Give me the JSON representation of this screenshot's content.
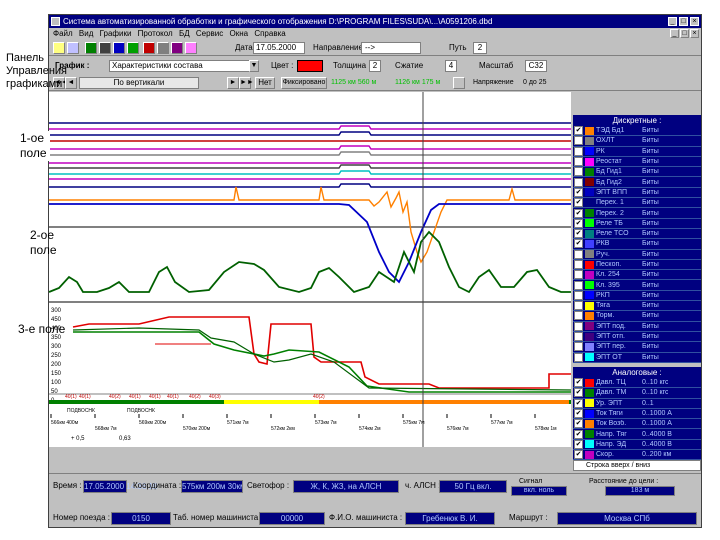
{
  "window": {
    "title": "Система автоматизированной обработки и графического отображения  D:\\PROGRAM FILES\\SUDA\\...\\A0591206.dbd",
    "controls": [
      "_",
      "□",
      "×"
    ]
  },
  "menu": [
    "Файл",
    "Вид",
    "Графики",
    "Протокол",
    "БД",
    "Сервис",
    "Окна",
    "Справка"
  ],
  "mdi_controls": [
    "_",
    "□",
    "×"
  ],
  "toolbar1": {
    "date_label": "Дата",
    "date_value": "17.05.2000",
    "direction_label": "Направление",
    "direction_value": "-->",
    "path_label": "Путь",
    "path_value": "2"
  },
  "toolbar2": {
    "graphic_label": "График :",
    "graphic_value": "Характеристики состава",
    "color_label": "Цвет :",
    "color_value": "#ff0000",
    "thickness_label": "Толщина",
    "thickness_value": "2",
    "scale_label": "Сжатие",
    "scale_value": "4",
    "zoom_label": "Масштаб",
    "zoom_value": "C32"
  },
  "toolbar3": {
    "nav_center": "По вертикали",
    "nav_btn": "Нет",
    "mode_btn": "Фиксировано",
    "coord1": "1125 км 560 м",
    "coord2": "1126 км 175 м",
    "coord_label": "Напряжение",
    "coord3": "0  до  25"
  },
  "colors": {
    "line_red": "#e00000",
    "line_green": "#008000",
    "line_blue": "#0000c8",
    "line_orange": "#ff8000",
    "line_magenta": "#c000c0",
    "line_darkgreen": "#006000",
    "accent_navy": "#000080"
  },
  "discrete_panel": {
    "title": "Дискретные :",
    "items": [
      {
        "checked": true,
        "color": "#ff8000",
        "name": "ТЭД Бд1",
        "value": "Биты"
      },
      {
        "checked": false,
        "color": "#808080",
        "name": "ОХЛТ",
        "value": "Биты"
      },
      {
        "checked": false,
        "color": "#0000ff",
        "name": "РК",
        "value": "Биты"
      },
      {
        "checked": false,
        "color": "#ff00ff",
        "name": "Реостат",
        "value": "Биты"
      },
      {
        "checked": false,
        "color": "#008000",
        "name": "Бд Гид1",
        "value": "Биты"
      },
      {
        "checked": false,
        "color": "#800000",
        "name": "Бд Гид2",
        "value": "Биты"
      },
      {
        "checked": true,
        "color": "#0000c0",
        "name": "ЭПТ ВПП",
        "value": "Биты"
      },
      {
        "checked": true,
        "color": "#000080",
        "name": "Перех. 1",
        "value": "Биты"
      },
      {
        "checked": true,
        "color": "#008000",
        "name": "Перех. 2",
        "value": "Биты"
      },
      {
        "checked": true,
        "color": "#00ff00",
        "name": "Реле ТБ",
        "value": "Биты"
      },
      {
        "checked": true,
        "color": "#008080",
        "name": "Реле ТСО",
        "value": "Биты"
      },
      {
        "checked": true,
        "color": "#4040ff",
        "name": "РКВ",
        "value": "Биты"
      },
      {
        "checked": false,
        "color": "#808080",
        "name": "Руч.",
        "value": "Биты"
      },
      {
        "checked": false,
        "color": "#ff0000",
        "name": "Пескоп.",
        "value": "Биты"
      },
      {
        "checked": false,
        "color": "#c000c0",
        "name": "Кл. 254",
        "value": "Биты"
      },
      {
        "checked": false,
        "color": "#00ff00",
        "name": "Кл. 395",
        "value": "Биты"
      },
      {
        "checked": false,
        "color": "#0000ff",
        "name": "РКП",
        "value": "Биты"
      },
      {
        "checked": false,
        "color": "#ffff00",
        "name": "Тяга",
        "value": "Биты"
      },
      {
        "checked": false,
        "color": "#ff8000",
        "name": "Торм.",
        "value": "Биты"
      },
      {
        "checked": false,
        "color": "#800080",
        "name": "ЭПТ под.",
        "value": "Биты"
      },
      {
        "checked": false,
        "color": "#400080",
        "name": "ЭПТ отп.",
        "value": "Биты"
      },
      {
        "checked": false,
        "color": "#8080ff",
        "name": "ЭПТ пер.",
        "value": "Биты"
      },
      {
        "checked": false,
        "color": "#00ffff",
        "name": "ЭПТ ОТ",
        "value": "Биты"
      }
    ]
  },
  "analog_panel": {
    "title": "Аналоговые :",
    "items": [
      {
        "checked": true,
        "color": "#ff0000",
        "name": "Давл. ТЦ",
        "value": "0..10 кгс"
      },
      {
        "checked": true,
        "color": "#008000",
        "name": "Давл. ТМ",
        "value": "0..10 кгс"
      },
      {
        "checked": true,
        "color": "#ffff00",
        "name": "Ур. ЭПТ",
        "value": "0..1"
      },
      {
        "checked": true,
        "color": "#0000ff",
        "name": "Ток Тяги",
        "value": "0..1000 А"
      },
      {
        "checked": true,
        "color": "#ff8000",
        "name": "Ток Возб.",
        "value": "0..1000 А"
      },
      {
        "checked": true,
        "color": "#008000",
        "name": "Напр. Тяг",
        "value": "0..4000 В"
      },
      {
        "checked": true,
        "color": "#00ffff",
        "name": "Напр. ЭД",
        "value": "0..4000 В"
      },
      {
        "checked": true,
        "color": "#c000c0",
        "name": "Скор.",
        "value": "0..200 км"
      }
    ],
    "footer": "Строка вверх / вниз"
  },
  "axes": {
    "field3_ticks": [
      "300",
      "450",
      "400",
      "350",
      "300",
      "250",
      "200",
      "150",
      "100",
      "50",
      "0"
    ],
    "x_ticks": [
      "566км 400м",
      "568км 7м",
      "569км 200м",
      "570км 200м",
      "571км 7м",
      "572км 2км",
      "573км 7м",
      "574км 2м",
      "575км 7м",
      "576км 7м",
      "577км 7м",
      "578км 1м"
    ],
    "event_labels": [
      "40(1)",
      "40(1)",
      "40(2)",
      "40(1)",
      "40(1)",
      "40(1)",
      "40(2)",
      "40(3)",
      "40(2)"
    ],
    "text_strip_1": "ПОДВОСНК",
    "text_strip_2": "ПОДВОСНК",
    "extra_labels": [
      "+ 0,5",
      "0,63"
    ]
  },
  "status": {
    "time_label": "Время :",
    "time_value": "17.05.2000 14:36:18",
    "coord_label": "Координата :",
    "coord_value": "575км 200м 30км",
    "speed_label": "Светофор :",
    "speed_value": "Ж, К, ЖЗ, на АЛСН",
    "alsn_label": "ч. АЛСН :",
    "alsn_value": "50 Гц вкл.",
    "signal_label": "Сигнал",
    "signal_value": "вкл. ноль",
    "distance_label": "Расстояние до цели :",
    "distance_value": "183 м",
    "train_label": "Номер поезда :",
    "train_value": "0150",
    "tab_label": "Таб. номер машиниста :",
    "tab_value": "00000",
    "driver_label": "Ф.И.О. машиниста :",
    "driver_value": "Гребенюк В. И.",
    "route_label": "Маршрут :",
    "route_value": "Москва СПб"
  },
  "annotations": {
    "panel_label": "Панель Управления графиками",
    "field1": "1-ое поле",
    "field2": "2-ое поле",
    "field3": "3-е поле"
  }
}
